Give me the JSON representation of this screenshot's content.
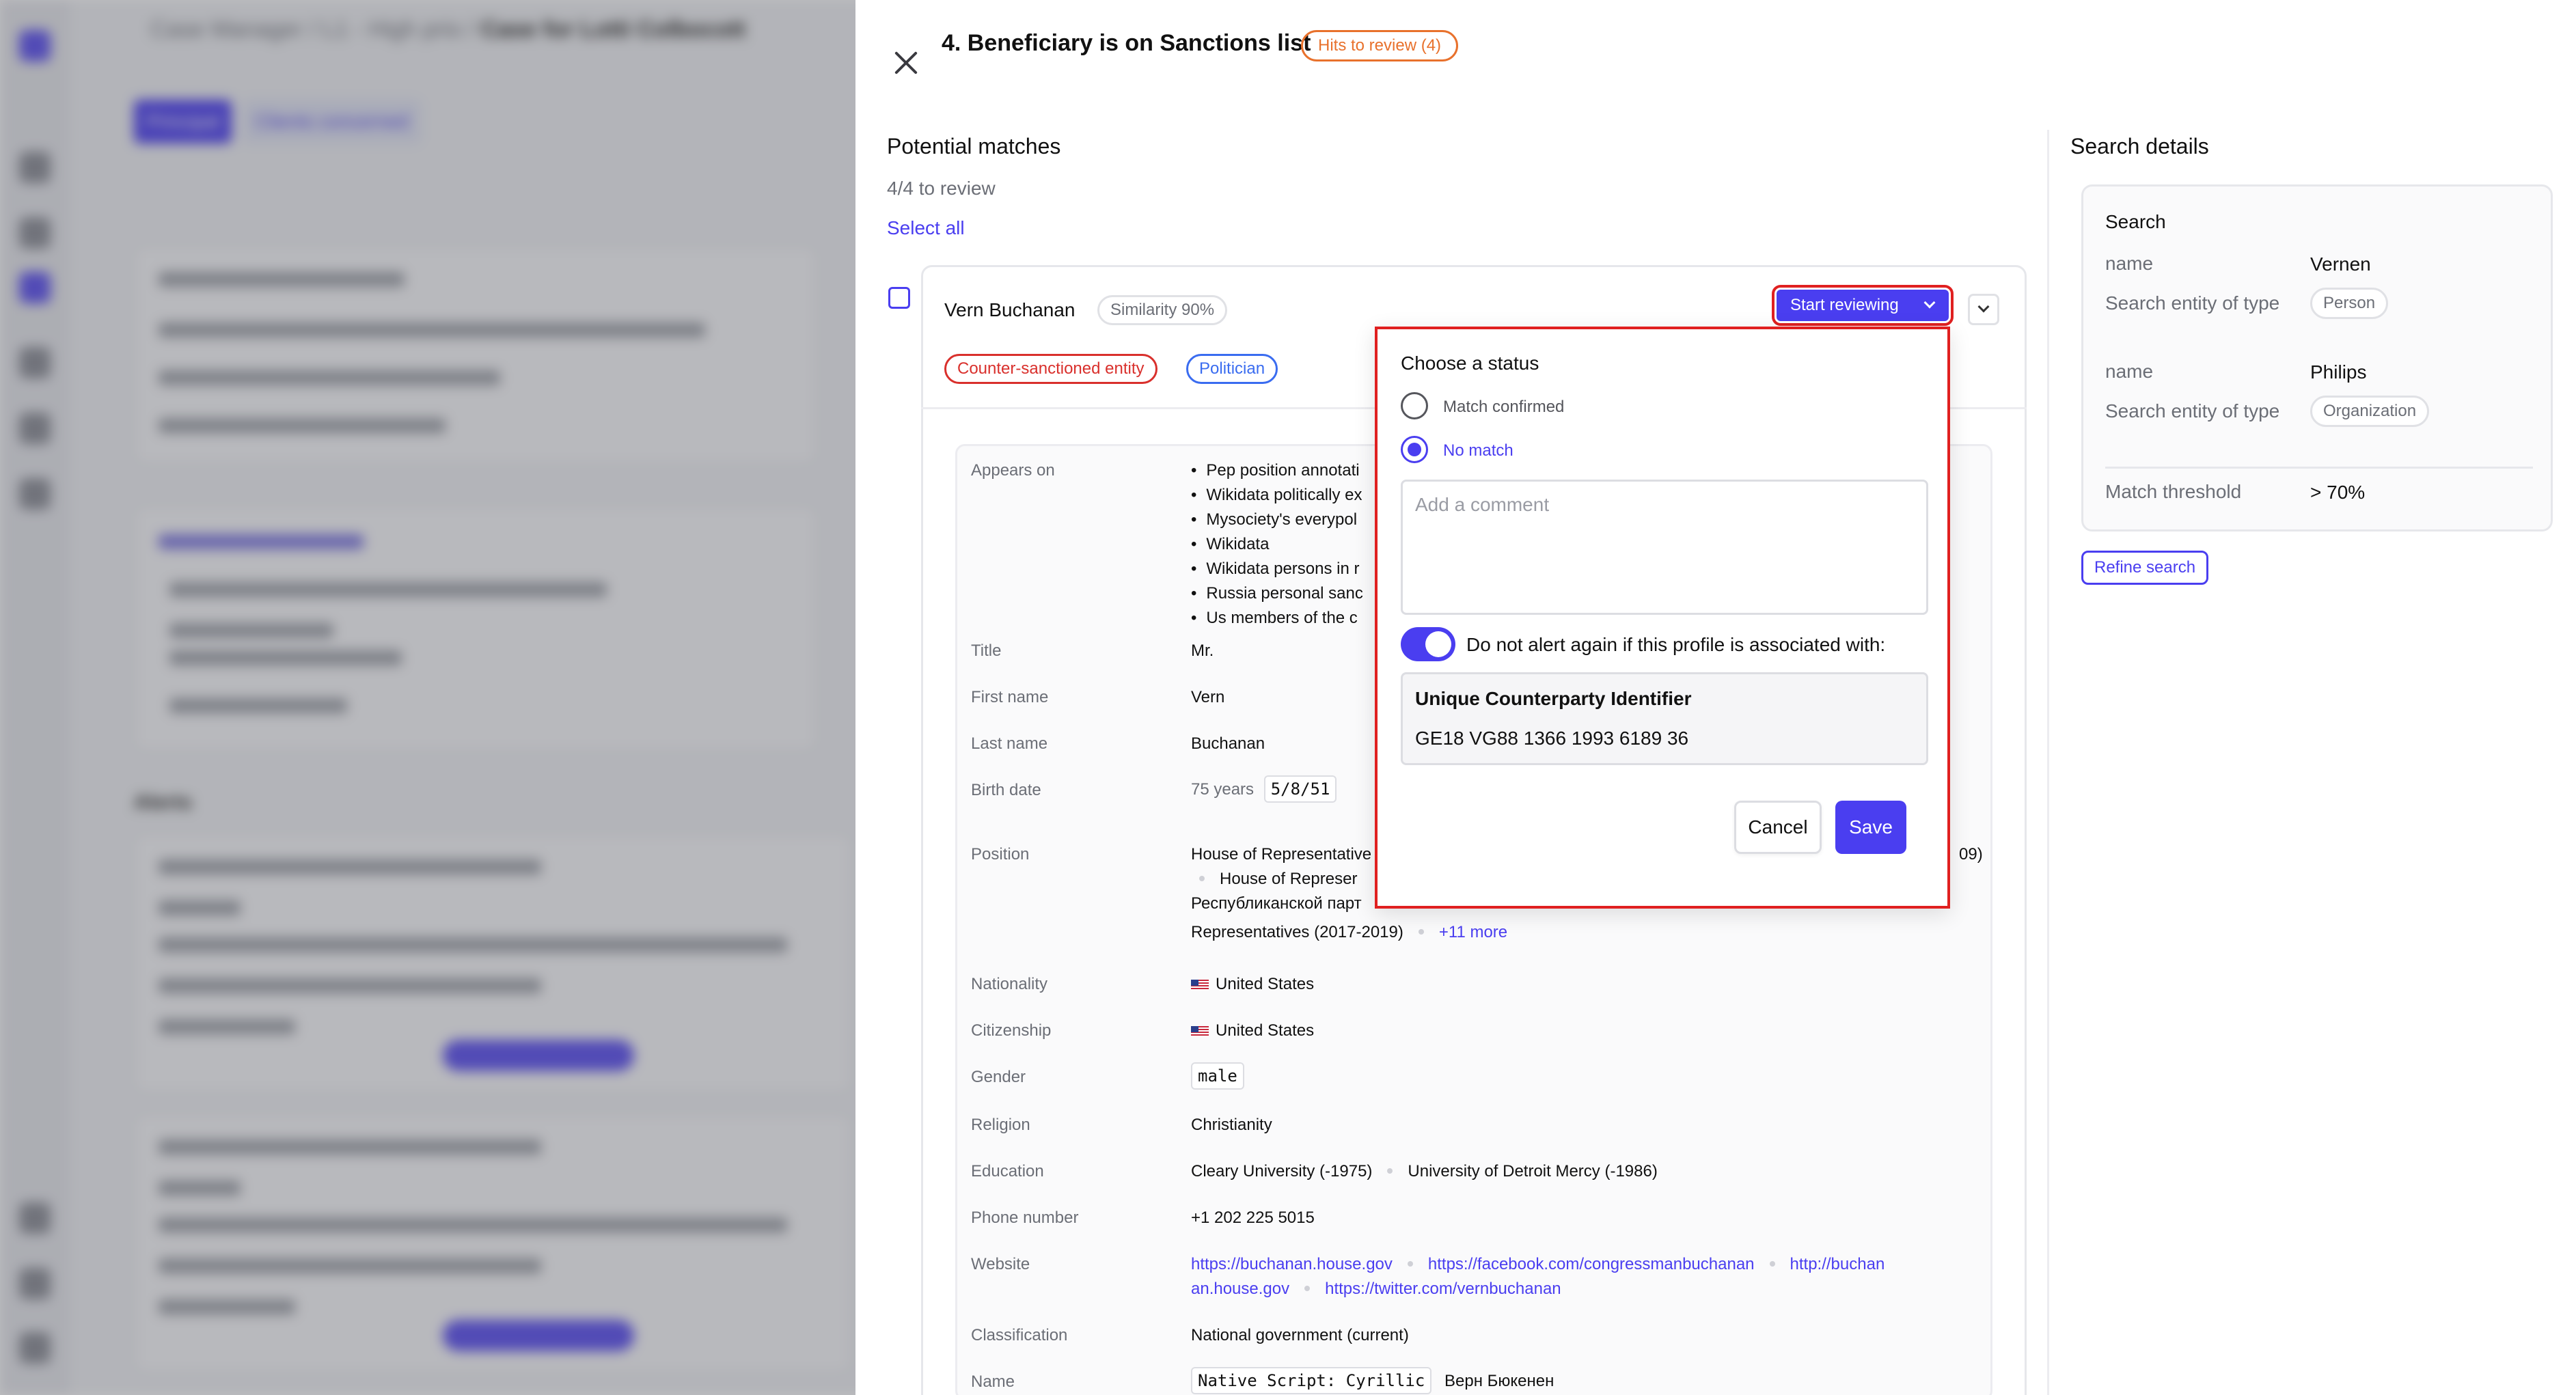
{
  "background": {
    "breadcrumb": [
      "Case Manager",
      "L1 - High prio",
      "Case for Lotti Colbocott"
    ],
    "tabs": [
      "Principal",
      "Clients concerned"
    ],
    "alerts_title": "Alerts"
  },
  "drawer": {
    "title": "4. Beneficiary is on Sanctions list",
    "hits_badge": "Hits to review (4)"
  },
  "matches": {
    "title": "Potential matches",
    "to_review": "4/4 to review",
    "select_all": "Select all",
    "item": {
      "name": "Vern Buchanan",
      "similarity": "Similarity 90%",
      "tags": [
        "Counter-sanctioned entity",
        "Politician"
      ],
      "start_reviewing": "Start reviewing"
    }
  },
  "details": {
    "appears_on_label": "Appears on",
    "appears_on": [
      "Pep position annotati",
      "Wikidata politically ex",
      "Mysociety's everypol",
      "Wikidata",
      "Wikidata persons in r",
      "Russia personal sanc",
      "Us members of the c"
    ],
    "title_label": "Title",
    "title": "Mr.",
    "first_name_label": "First name",
    "first_name": "Vern",
    "last_name_label": "Last name",
    "last_name": "Buchanan",
    "birth_label": "Birth date",
    "age": "75 years",
    "birth_date": "5/8/51",
    "position_label": "Position",
    "position_line1": "House of Representative",
    "position_line1_end": "09)",
    "position_line2": "House of Represer",
    "position_line3": "Республиканской парт",
    "position_line4": "Representatives (2017-2019)",
    "position_more": "+11 more",
    "nationality_label": "Nationality",
    "nationality": "United States",
    "citizenship_label": "Citizenship",
    "citizenship": "United States",
    "gender_label": "Gender",
    "gender": "male",
    "religion_label": "Religion",
    "religion": "Christianity",
    "education_label": "Education",
    "education": [
      "Cleary University (-1975)",
      "University of Detroit Mercy (-1986)"
    ],
    "phone_label": "Phone number",
    "phone": "+1 202 225 5015",
    "website_label": "Website",
    "websites": [
      "https://buchanan.house.gov",
      "https://facebook.com/congressmanbuchanan",
      "http://buchan",
      "an.house.gov",
      "https://twitter.com/vernbuchanan"
    ],
    "classification_label": "Classification",
    "classification": "National government (current)",
    "name_label": "Name",
    "name_script": "Native Script: Cyrillic",
    "name_value": "Верн Бюкенен"
  },
  "status_popover": {
    "title": "Choose a status",
    "options": [
      "Match confirmed",
      "No match"
    ],
    "selected": "No match",
    "comment_placeholder": "Add a comment",
    "do_not_alert": "Do not alert again if this profile is associated with:",
    "uci_label": "Unique Counterparty Identifier",
    "uci_value": "GE18 VG88 1366 1993 6189 36",
    "cancel": "Cancel",
    "save": "Save"
  },
  "search_details": {
    "title": "Search details",
    "card_title": "Search",
    "name_label_1": "name",
    "name_value_1": "Vernen",
    "type_label_1": "Search entity of type",
    "type_value_1": "Person",
    "name_label_2": "name",
    "name_value_2": "Philips",
    "type_label_2": "Search entity of type",
    "type_value_2": "Organization",
    "threshold_label": "Match threshold",
    "threshold_value": "> 70%",
    "refine": "Refine search"
  },
  "colors": {
    "accent": "#4a3ef0",
    "danger": "#d9302c",
    "warning": "#e8712c",
    "highlight": "#e02020"
  }
}
